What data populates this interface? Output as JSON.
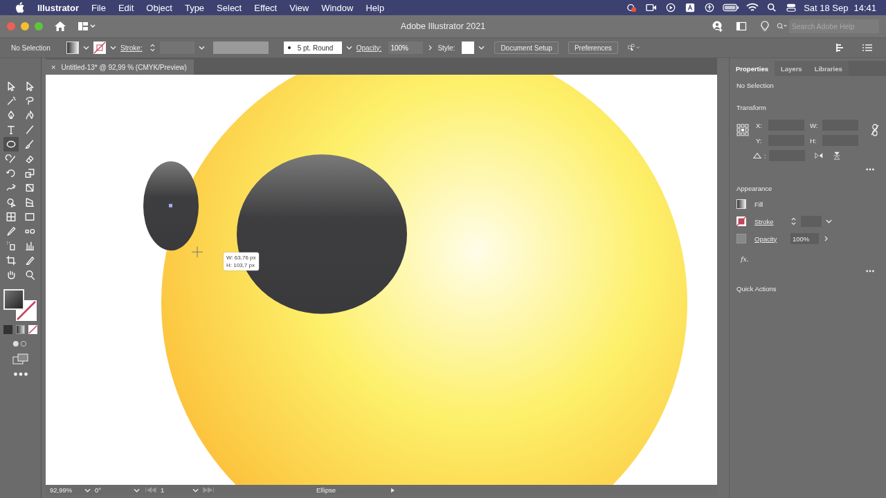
{
  "menubar": {
    "app": "Illustrator",
    "items": [
      "File",
      "Edit",
      "Object",
      "Type",
      "Select",
      "Effect",
      "View",
      "Window",
      "Help"
    ],
    "date": "Sat 18 Sep",
    "time": "14:41"
  },
  "window": {
    "title": "Adobe Illustrator 2021",
    "search_placeholder": "Search Adobe Help"
  },
  "control_bar": {
    "selection": "No Selection",
    "stroke_label": "Stroke:",
    "brush": "5 pt. Round",
    "opacity_label": "Opacity:",
    "opacity": "100%",
    "style_label": "Style:",
    "buttons": [
      "Document Setup",
      "Preferences"
    ]
  },
  "document_tab": {
    "title": "Untitled-13* @ 92,99 % (CMYK/Preview)",
    "close": "×"
  },
  "tools": [
    {
      "kind": "select",
      "selected": false
    },
    {
      "kind": "direct",
      "selected": false
    },
    {
      "kind": "wand",
      "selected": false
    },
    {
      "kind": "lasso",
      "selected": false
    },
    {
      "kind": "pen",
      "selected": false
    },
    {
      "kind": "curve",
      "selected": false
    },
    {
      "kind": "type",
      "selected": false
    },
    {
      "kind": "line",
      "selected": false
    },
    {
      "kind": "ellipse",
      "selected": true
    },
    {
      "kind": "brush",
      "selected": false
    },
    {
      "kind": "pencil",
      "selected": false
    },
    {
      "kind": "eraser",
      "selected": false
    },
    {
      "kind": "rotate",
      "selected": false
    },
    {
      "kind": "scale",
      "selected": false
    },
    {
      "kind": "warp",
      "selected": false
    },
    {
      "kind": "transform",
      "selected": false
    },
    {
      "kind": "builder",
      "selected": false
    },
    {
      "kind": "grid",
      "selected": false
    },
    {
      "kind": "mesh",
      "selected": false
    },
    {
      "kind": "gradient",
      "selected": false
    },
    {
      "kind": "eyedropper",
      "selected": false
    },
    {
      "kind": "blend",
      "selected": false
    },
    {
      "kind": "spray",
      "selected": false
    },
    {
      "kind": "graph",
      "selected": false
    },
    {
      "kind": "artboard",
      "selected": false
    },
    {
      "kind": "knife",
      "selected": false
    },
    {
      "kind": "hand",
      "selected": false
    },
    {
      "kind": "zoom",
      "selected": false
    }
  ],
  "tooltip": {
    "width": "W: 63,76 px",
    "height": "H: 103,7 px"
  },
  "panel": {
    "tabs": [
      {
        "label": "Properties",
        "selected": true
      },
      {
        "label": "Layers",
        "selected": false
      },
      {
        "label": "Libraries",
        "selected": false
      }
    ],
    "selection": "No Selection",
    "transform_title": "Transform",
    "x_label": "X:",
    "y_label": "Y:",
    "w_label": "W:",
    "h_label": "H:",
    "angle_label": ":",
    "appearance_title": "Appearance",
    "fill_label": "Fill",
    "stroke_label": "Stroke",
    "opacity_label": "Opacity",
    "opacity": "100%",
    "fx": "fx.",
    "quick_actions": "Quick Actions"
  },
  "status_bar": {
    "zoom": "92,99%",
    "rotation": "0°",
    "artboard": "1",
    "tool": "Ellipse"
  }
}
